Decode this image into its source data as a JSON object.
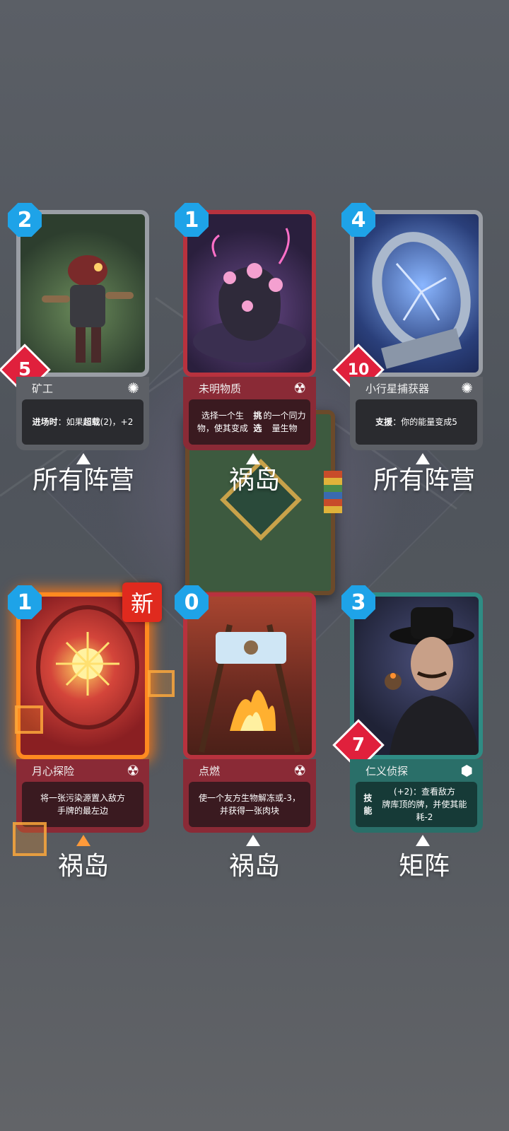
{
  "cards": [
    {
      "cost": "2",
      "power": "5",
      "name": "矿工",
      "desc_html": "<b>进场时</b>：如果<b>超载</b>(2)，+2",
      "faction": "所有阵营",
      "type_icon": "sun-icon",
      "new": false
    },
    {
      "cost": "1",
      "power": "",
      "name": "未明物质",
      "desc_html": "选择一个生物，使其变成<br><b>挑选</b>的一个同力量生物",
      "faction": "祸岛",
      "type_icon": "radiation-icon",
      "new": false
    },
    {
      "cost": "4",
      "power": "10",
      "name": "小行星捕获器",
      "desc_html": "<b>支援</b>：你的能量变成5",
      "faction": "所有阵营",
      "type_icon": "sun-icon",
      "new": false
    },
    {
      "cost": "1",
      "power": "",
      "name": "月心探险",
      "desc_html": "将一张污染源置入敌方<br>手牌的最左边",
      "faction": "祸岛",
      "type_icon": "radiation-icon",
      "new": true,
      "new_label": "新"
    },
    {
      "cost": "0",
      "power": "",
      "name": "点燃",
      "desc_html": "使一个友方生物解冻或-3，<br>并获得一张肉块",
      "faction": "祸岛",
      "type_icon": "radiation-icon",
      "new": false
    },
    {
      "cost": "3",
      "power": "7",
      "name": "仁义侦探",
      "desc_html": "<b>技能</b>(+2)：查看敌方<br>牌库顶的牌，并使其能耗-2",
      "faction": "矩阵",
      "type_icon": "cube-icon",
      "new": false
    }
  ],
  "colors": {
    "cost": "#1ea3e8",
    "power": "#e0203c",
    "new_badge": "#e02a1e"
  }
}
